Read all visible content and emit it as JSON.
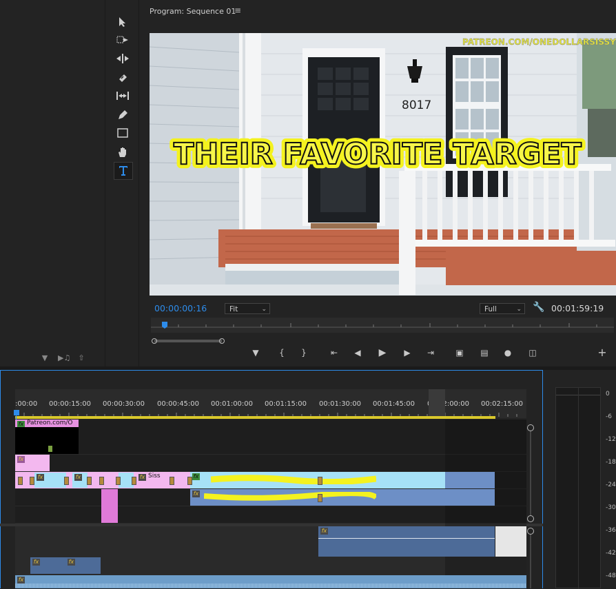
{
  "program": {
    "title": "Program: Sequence 01",
    "menu_icon": "hamburger-icon",
    "video": {
      "caption": "THEIR FAVORITE TARGET",
      "watermark": "PATREON.COM/ONEDOLLARSISSY",
      "house_number": "8017"
    },
    "timecode_current": "00:00:00:16",
    "zoom_select": "Fit",
    "resolution_select": "Full",
    "timecode_duration": "00:01:59:19"
  },
  "tools": [
    "selection-tool",
    "track-select-tool",
    "ripple-edit-tool",
    "razor-tool",
    "slip-tool",
    "pen-tool",
    "rectangle-tool",
    "hand-tool",
    "type-tool"
  ],
  "transport": [
    "add-marker",
    "mark-in",
    "mark-out",
    "go-to-in",
    "step-back",
    "play",
    "step-forward",
    "go-to-out",
    "lift",
    "extract",
    "export-frame",
    "comparison-view",
    "add-button"
  ],
  "timeline": {
    "ruler_labels": [
      ":00:00",
      "00:00:15:00",
      "00:00:30:00",
      "00:00:45:00",
      "00:01:00:00",
      "00:01:15:00",
      "00:01:30:00",
      "00:01:45:00",
      "00:02:00:00",
      "00:02:15:00"
    ],
    "clips": {
      "v4_label": "Patreon.com/O",
      "v2_label": "Siss"
    }
  },
  "meter": {
    "db_labels": [
      "0",
      "-6",
      "-12",
      "-18",
      "-24",
      "-30",
      "-36",
      "-42",
      "-48"
    ]
  },
  "colors": {
    "accent": "#2d8ceb",
    "clip_pink": "#f3b8ef",
    "clip_magenta": "#e07ad8",
    "clip_lightblue": "#a6e1f7",
    "clip_blue": "#6d8fc6",
    "caption_yellow": "#f4f21f"
  }
}
